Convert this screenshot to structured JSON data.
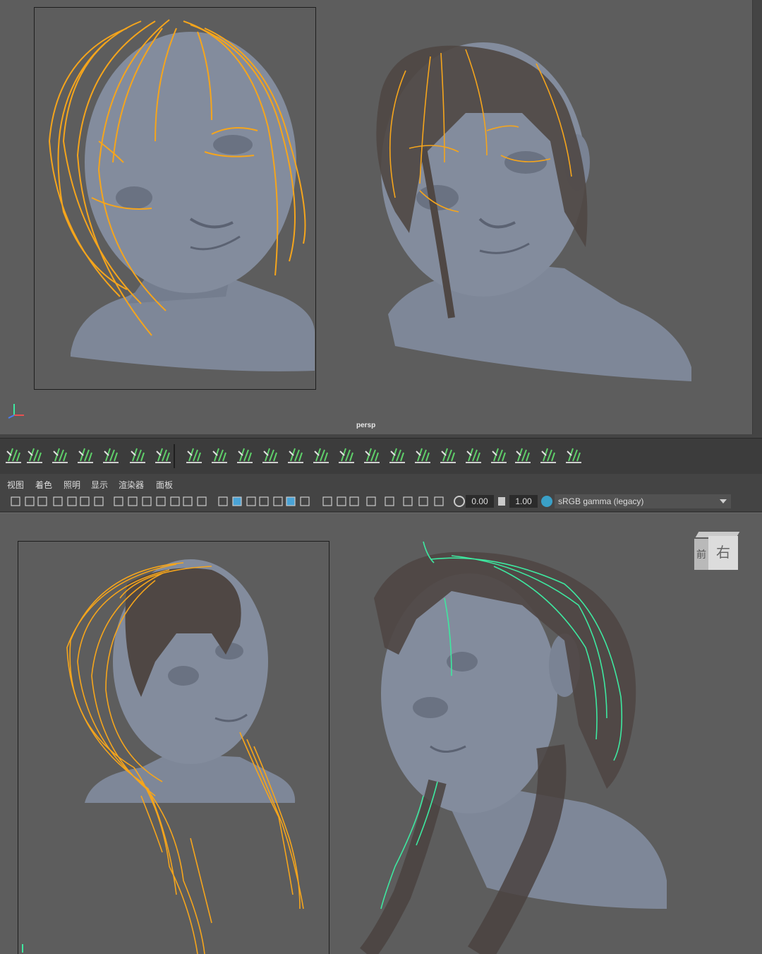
{
  "top_viewport": {
    "camera_label": "persp"
  },
  "menu": {
    "items": [
      "视图",
      "着色",
      "照明",
      "显示",
      "渲染器",
      "面板"
    ]
  },
  "toolbar": {
    "exposure_value": "0.00",
    "gamma_value": "1.00",
    "color_space": "sRGB gamma (legacy)"
  },
  "viewcube": {
    "front_label": "前",
    "right_label": "右"
  },
  "colors": {
    "viewport_bg": "#5d5d5d",
    "hair_guides": "#f5a51c",
    "selected_guides": "#3ee8a0",
    "head_mesh": "#7e8798",
    "shelf_icon_green": "#5fcf6a"
  },
  "shelf": {
    "icons": [
      "hair-layer-icon",
      "grid-plane-icon",
      "scale-guides-icon",
      "cut-guides-icon",
      "comb-icon",
      "delete-guides-icon",
      "export-guides-icon",
      "preview-render-icon",
      "add-guides-icon",
      "add-curves-icon",
      "brush-grab-icon",
      "brush-smooth-icon",
      "brush-pinch-icon",
      "brush-cut-icon",
      "brush-clump-icon",
      "brush-twist-icon",
      "brush-length-icon",
      "brush-lift-icon",
      "brush-bend-icon",
      "brush-noise-icon",
      "brush-frizz-icon",
      "brush-scatter-icon",
      "brush-density-icon",
      "brush-width-icon",
      "settings-icon",
      "brush-select-icon"
    ]
  }
}
